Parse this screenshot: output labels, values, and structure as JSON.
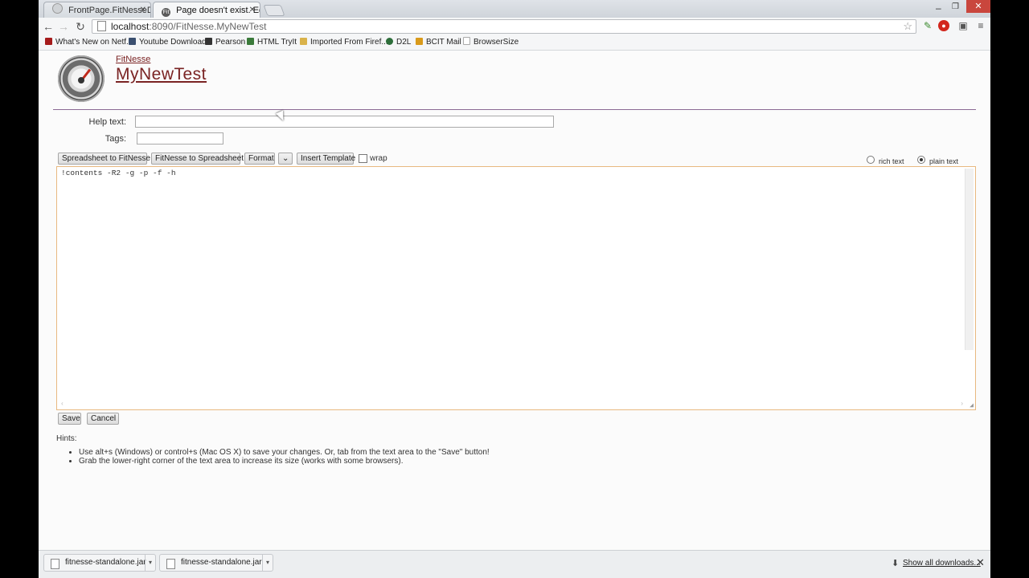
{
  "tabs": [
    {
      "label": "FrontPage.FitNesseDevelo",
      "active": false
    },
    {
      "label": "Page doesn't exist. Edit: Fi",
      "active": true
    }
  ],
  "address": {
    "host": "localhost",
    "path": ":8090/FitNesse.MyNewTest"
  },
  "bookmarks": [
    {
      "label": "What's New on Netf...",
      "icon": "netflix-icon",
      "color": "#a51b1b"
    },
    {
      "label": "Youtube Download",
      "icon": "youtube-download-icon",
      "color": "#3a4f6f"
    },
    {
      "label": "Pearson",
      "icon": "pearson-icon",
      "color": "#333333"
    },
    {
      "label": "HTML TryIt",
      "icon": "html-tryit-icon",
      "color": "#3a7a3a"
    },
    {
      "label": "Imported From Firef...",
      "icon": "folder-icon",
      "color": "#d9b24a"
    },
    {
      "label": "D2L",
      "icon": "d2l-icon",
      "color": "#2d6e3a"
    },
    {
      "label": "BCIT Mail",
      "icon": "bcit-mail-icon",
      "color": "#d99a1a"
    },
    {
      "label": "BrowserSize",
      "icon": "page-icon",
      "color": "#aaaaaa"
    }
  ],
  "page": {
    "breadcrumb": "FitNesse",
    "title": "MyNewTest",
    "help_label": "Help text:",
    "tags_label": "Tags:",
    "help_value": "",
    "tags_value": ""
  },
  "toolbar_buttons": {
    "spreadsheet_to_fitnesse": "Spreadsheet to FitNesse",
    "fitnesse_to_spreadsheet": "FitNesse to Spreadsheet",
    "format": "Format",
    "template_select": "",
    "insert_template": "Insert Template",
    "wrap": "wrap",
    "rich_text": "rich text",
    "plain_text": "plain text",
    "selected_mode": "plain text"
  },
  "editor": {
    "content": "!contents -R2 -g -p -f -h"
  },
  "actions": {
    "save": "Save",
    "cancel": "Cancel"
  },
  "hints": {
    "title": "Hints:",
    "items": [
      "Use alt+s (Windows) or control+s (Mac OS X) to save your changes. Or, tab from the text area to the \"Save\" button!",
      "Grab the lower-right corner of the text area to increase its size (works with some browsers)."
    ]
  },
  "downloads": {
    "items": [
      "fitnesse-standalone.jar",
      "fitnesse-standalone.jar"
    ],
    "show_all": "Show all downloads..."
  }
}
